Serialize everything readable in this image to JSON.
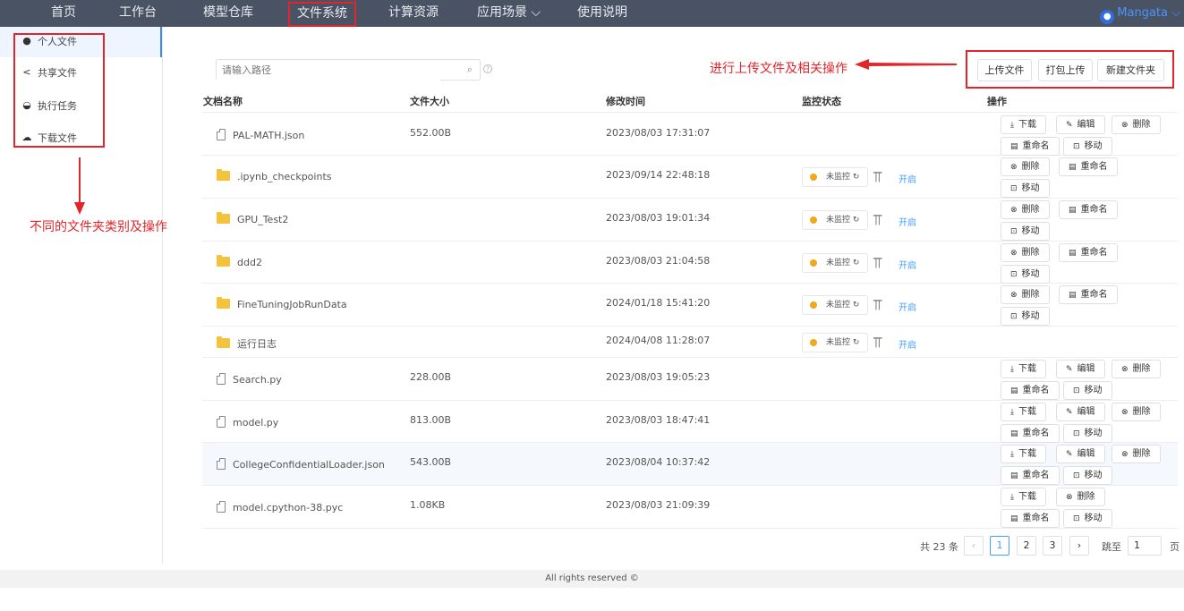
{
  "nav": {
    "items": [
      "首页",
      "工作台",
      "模型仓库",
      "文件系统",
      "计算资源",
      "应用场景 ⌵",
      "使用说明"
    ],
    "active": "文件系统",
    "user": "Mangata"
  },
  "sidebar": {
    "items": [
      {
        "label": "个人文件",
        "icon": "user-icon"
      },
      {
        "label": "共享文件",
        "icon": "share-icon"
      },
      {
        "label": "执行任务",
        "icon": "task-icon"
      },
      {
        "label": "下载文件",
        "icon": "cloud-download-icon"
      }
    ]
  },
  "annotations": {
    "sidebar_note": "不同的文件夹类别及操作",
    "toolbar_note": "进行上传文件及相关操作"
  },
  "search": {
    "placeholder": "请输入路径"
  },
  "toolbar": {
    "upload": "上传文件",
    "pack_upload": "打包上传",
    "new_folder": "新建文件夹"
  },
  "table": {
    "headers": {
      "name": "文档名称",
      "size": "文件大小",
      "mtime": "修改时间",
      "monitor": "监控状态",
      "ops": "操作"
    },
    "monitor_label": "未监控",
    "monitor_open": "开启",
    "op_labels": {
      "download": "下载",
      "edit": "编辑",
      "delete": "删除",
      "rename": "重命名",
      "move": "移动"
    },
    "rows": [
      {
        "name": "PAL-MATH.json",
        "type": "file",
        "size": "552.00B",
        "mtime": "2023/08/03 17:31:07"
      },
      {
        "name": ".ipynb_checkpoints",
        "type": "folder",
        "size": "",
        "mtime": "2023/09/14 22:48:18"
      },
      {
        "name": "GPU_Test2",
        "type": "folder",
        "size": "",
        "mtime": "2023/08/03 19:01:34"
      },
      {
        "name": "ddd2",
        "type": "folder",
        "size": "",
        "mtime": "2023/08/03 21:04:58"
      },
      {
        "name": "FineTuningJobRunData",
        "type": "folder",
        "size": "",
        "mtime": "2024/01/18 15:41:20"
      },
      {
        "name": "运行日志",
        "type": "folder",
        "size": "",
        "mtime": "2024/04/08 11:28:07"
      },
      {
        "name": "Search.py",
        "type": "file",
        "size": "228.00B",
        "mtime": "2023/08/03 19:05:23"
      },
      {
        "name": "model.py",
        "type": "file",
        "size": "813.00B",
        "mtime": "2023/08/03 18:47:41"
      },
      {
        "name": "CollegeConfidentialLoader.json",
        "type": "file",
        "size": "543.00B",
        "mtime": "2023/08/04 10:37:42"
      },
      {
        "name": "model.cpython-38.pyc",
        "type": "file",
        "size": "1.08KB",
        "mtime": "2023/08/03 21:09:39"
      }
    ]
  },
  "pagination": {
    "total": "共 23 条",
    "pages": [
      "1",
      "2",
      "3"
    ],
    "current": "1",
    "goto_label": "跳至",
    "goto_value": "1",
    "page_unit": "页"
  },
  "footer": "All rights reserved ©",
  "colors": {
    "nav_bg": "#4a5363",
    "annotation_red": "#e0262b",
    "accent": "#409eff",
    "folder": "#f5c33b",
    "monitor_dot": "#f0a81d"
  }
}
